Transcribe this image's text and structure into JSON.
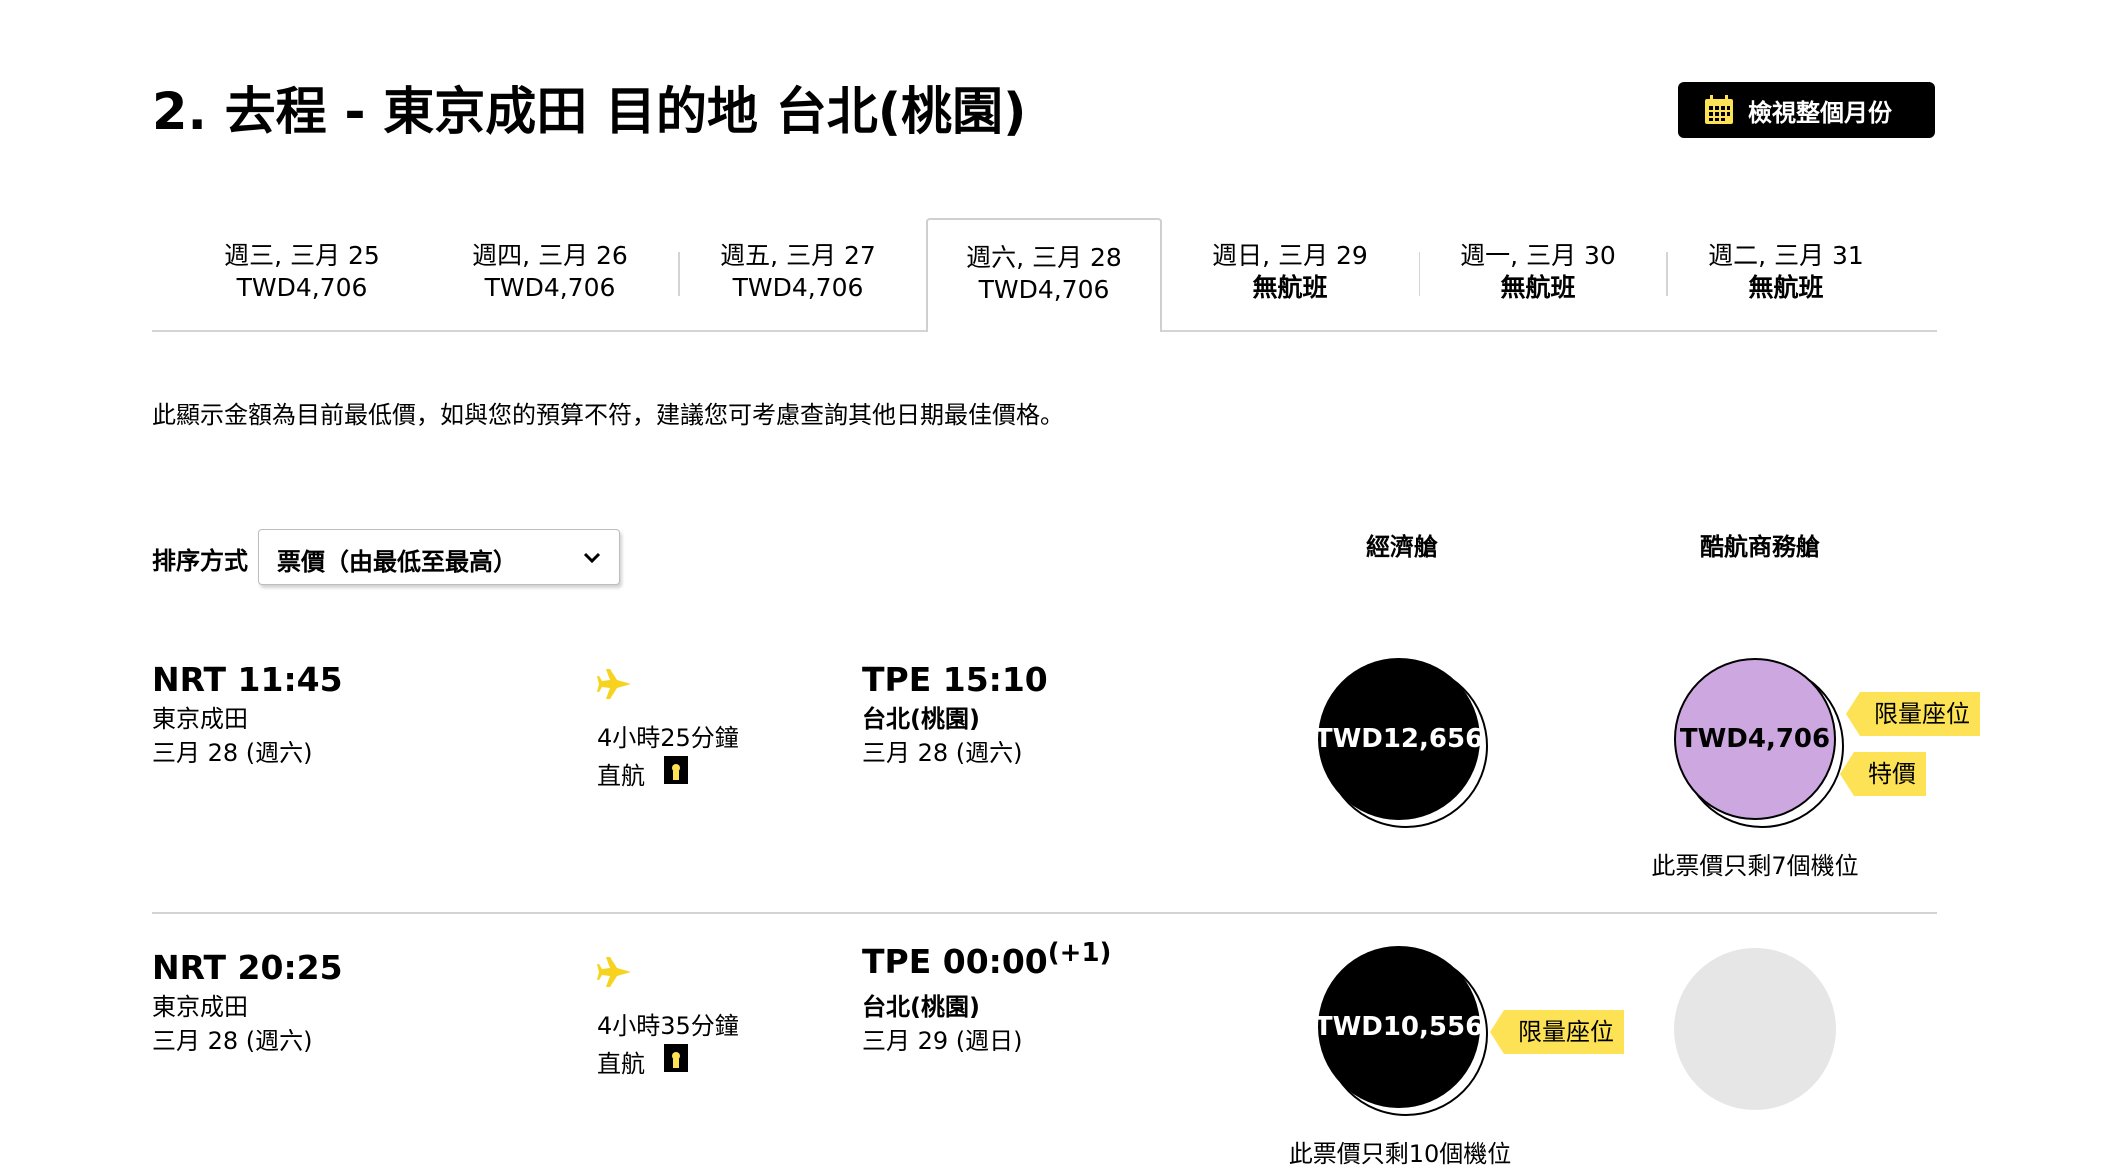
{
  "header": {
    "title": "2. 去程 - 東京成田 目的地 台北(桃園)",
    "month_button": "檢視整個月份"
  },
  "date_tabs": [
    {
      "date": "週三, 三月 25",
      "price": "TWD4,706",
      "active": false
    },
    {
      "date": "週四, 三月 26",
      "price": "TWD4,706",
      "active": false
    },
    {
      "date": "週五, 三月 27",
      "price": "TWD4,706",
      "active": false
    },
    {
      "date": "週六, 三月 28",
      "price": "TWD4,706",
      "active": true
    },
    {
      "date": "週日, 三月 29",
      "price": "無航班",
      "active": false
    },
    {
      "date": "週一, 三月 30",
      "price": "無航班",
      "active": false
    },
    {
      "date": "週二, 三月 31",
      "price": "無航班",
      "active": false
    }
  ],
  "note": "此顯示金額為目前最低價，如與您的預算不符，建議您可考慮查詢其他日期最佳價格。",
  "sort": {
    "label": "排序方式",
    "selected": "票價（由最低至最高）"
  },
  "columns": {
    "economy": "經濟艙",
    "business": "酷航商務艙"
  },
  "flights": [
    {
      "dep_code_time": "NRT 11:45",
      "dep_city": "東京成田",
      "dep_date": "三月 28 (週六)",
      "duration": "4小時25分鐘",
      "stops": "直航",
      "arr_code_time": "TPE 15:10",
      "arr_day_offset": "",
      "arr_city": "台北(桃園)",
      "arr_date": "三月 28 (週六)",
      "economy_price": "TWD12,656",
      "business_price": "TWD4,706",
      "business_tags": [
        "限量座位",
        "特價"
      ],
      "business_seats_left": "此票價只剩7個機位"
    },
    {
      "dep_code_time": "NRT 20:25",
      "dep_city": "東京成田",
      "dep_date": "三月 28 (週六)",
      "duration": "4小時35分鐘",
      "stops": "直航",
      "arr_code_time": "TPE 00:00",
      "arr_day_offset": "(+1)",
      "arr_city": "台北(桃園)",
      "arr_date": "三月 29 (週日)",
      "economy_price": "TWD10,556",
      "economy_tag": "限量座位",
      "economy_seats_left": "此票價只剩10個機位"
    }
  ],
  "colors": {
    "accent_yellow": "#fce254",
    "plane_yellow": "#f7d21e",
    "business_purple": "#cda8e0",
    "empty_grey": "#e6e6e6"
  }
}
